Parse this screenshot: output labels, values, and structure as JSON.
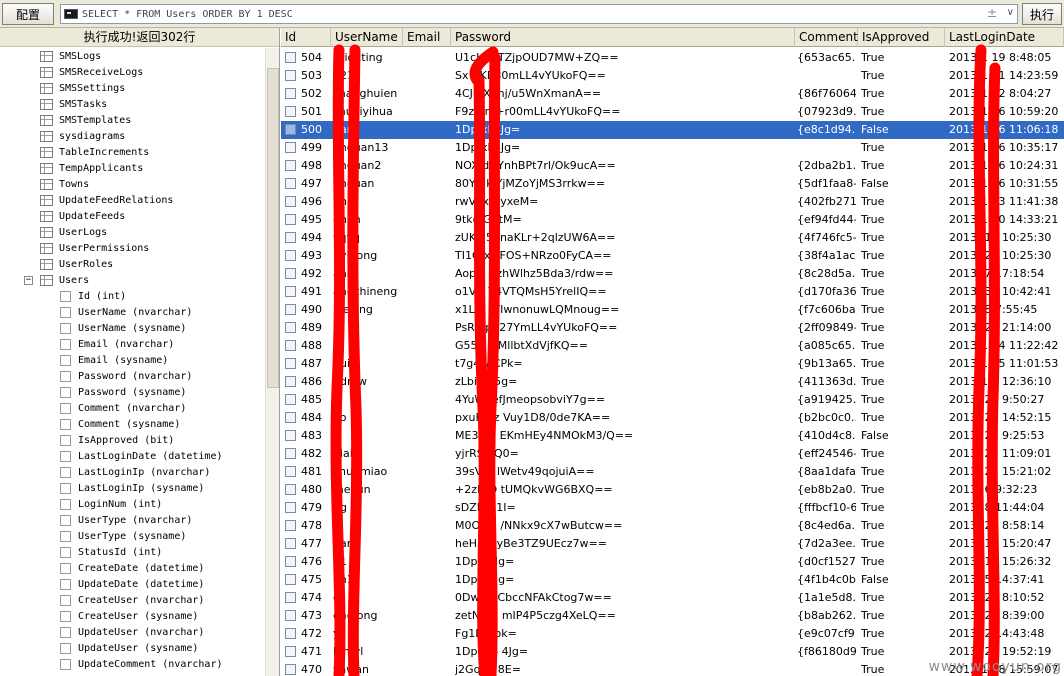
{
  "toolbar": {
    "config_label": "配置",
    "sql": "SELECT * FROM Users ORDER BY 1 DESC",
    "plus": "±",
    "dropdown": "∨",
    "exec_label": "执行"
  },
  "status": "执行成功!返回302行",
  "tree": [
    {
      "label": "SMSLogs",
      "type": "table"
    },
    {
      "label": "SMSReceiveLogs",
      "type": "table"
    },
    {
      "label": "SMSSettings",
      "type": "table"
    },
    {
      "label": "SMSTasks",
      "type": "table"
    },
    {
      "label": "SMSTemplates",
      "type": "table"
    },
    {
      "label": "sysdiagrams",
      "type": "table"
    },
    {
      "label": "TableIncrements",
      "type": "table"
    },
    {
      "label": "TempApplicants",
      "type": "table"
    },
    {
      "label": "Towns",
      "type": "table"
    },
    {
      "label": "UpdateFeedRelations",
      "type": "table"
    },
    {
      "label": "UpdateFeeds",
      "type": "table"
    },
    {
      "label": "UserLogs",
      "type": "table"
    },
    {
      "label": "UserPermissions",
      "type": "table"
    },
    {
      "label": "UserRoles",
      "type": "table"
    },
    {
      "label": "Users",
      "type": "table",
      "expanded": true,
      "expander": "−"
    },
    {
      "label": "Id (int)",
      "type": "column"
    },
    {
      "label": "UserName (nvarchar)",
      "type": "column"
    },
    {
      "label": "UserName (sysname)",
      "type": "column"
    },
    {
      "label": "Email (nvarchar)",
      "type": "column"
    },
    {
      "label": "Email (sysname)",
      "type": "column"
    },
    {
      "label": "Password (nvarchar)",
      "type": "column"
    },
    {
      "label": "Password (sysname)",
      "type": "column"
    },
    {
      "label": "Comment (nvarchar)",
      "type": "column"
    },
    {
      "label": "Comment (sysname)",
      "type": "column"
    },
    {
      "label": "IsApproved (bit)",
      "type": "column"
    },
    {
      "label": "LastLoginDate (datetime)",
      "type": "column"
    },
    {
      "label": "LastLoginIp (nvarchar)",
      "type": "column"
    },
    {
      "label": "LastLoginIp (sysname)",
      "type": "column"
    },
    {
      "label": "LoginNum (int)",
      "type": "column"
    },
    {
      "label": "UserType (nvarchar)",
      "type": "column"
    },
    {
      "label": "UserType (sysname)",
      "type": "column"
    },
    {
      "label": "StatusId (int)",
      "type": "column"
    },
    {
      "label": "CreateDate (datetime)",
      "type": "column"
    },
    {
      "label": "UpdateDate (datetime)",
      "type": "column"
    },
    {
      "label": "CreateUser (nvarchar)",
      "type": "column"
    },
    {
      "label": "CreateUser (sysname)",
      "type": "column"
    },
    {
      "label": "UpdateUser (nvarchar)",
      "type": "column"
    },
    {
      "label": "UpdateUser (sysname)",
      "type": "column"
    },
    {
      "label": "UpdateComment (nvarchar)",
      "type": "column"
    }
  ],
  "grid": {
    "columns": [
      "Id",
      "UserName",
      "Email",
      "Password",
      "Comment",
      "IsApproved",
      "LastLoginDate"
    ],
    "selected_row": 4,
    "rows": [
      [
        "504",
        "ruiouting",
        "",
        "U1cH  qiTZjpOUD7MW+ZQ==",
        "{653ac65...",
        "True",
        "2013-1  19 8:48:05"
      ],
      [
        "503",
        "  1212",
        "",
        "Sx  CKB80mLL4vYUkoFQ==",
        "",
        "True",
        "2013-1  31 14:23:59"
      ],
      [
        "502",
        "zhanghuien",
        "",
        "4CJ  TX2hj/u5WnXmanA==",
        "{86f76064...",
        "True",
        "2013-1  12 8:04:27"
      ],
      [
        "501",
        "zhuaiyihua",
        "",
        "F9z  0m+r00mLL4vYUkoFQ==",
        "{07923d9...",
        "True",
        "2013-1  16 10:59:20"
      ],
      [
        "500",
        "  dan",
        "",
        "1Dp  xk4Jg=",
        "{e8c1d94...",
        "False",
        "2013-1  16 11:06:18"
      ],
      [
        "499",
        "  anquan13",
        "",
        "1Dp  xk4Jg=",
        "",
        "True",
        "2013-1  16 10:35:17"
      ],
      [
        "498",
        "  anquan2",
        "",
        "NOX  dOYnhBPt7rl/Ok9ucA==",
        "{2dba2b1...",
        "True",
        "2013-1  16 10:24:31"
      ],
      [
        "497",
        "  anquan",
        "",
        "80Yb  kjYjMZoYjMS3rrkw==",
        "{5df1faa8-...",
        "False",
        "2013-1  16 10:31:55"
      ],
      [
        "496",
        "  ung",
        "",
        "rwVxx  CyxeM=",
        "{402fb271...",
        "True",
        "2013-1  13 11:41:38"
      ],
      [
        "495",
        "  gnan",
        "",
        "9tkd  GntM=",
        "{ef94fd44-...",
        "True",
        "2013-1  30 14:33:21"
      ],
      [
        "494",
        "  yqyq",
        "",
        "zUKu  53naKLr+2qlzUW6A==",
        "{4f746fc5-...",
        "True",
        "2013-  10 10:25:30"
      ],
      [
        "493",
        "  nyulong",
        "",
        "TI1G  xwFOS+NRzo0FyCA==",
        "{38f4a1ac...",
        "True",
        "2013-  22 10:25:30"
      ],
      [
        "492",
        "  ang",
        "",
        "Aopel  qzhWlhz5Bda3/rdw==",
        "{8c28d5a...",
        "True",
        "2013-  7 17:18:54"
      ],
      [
        "491",
        "  angzhineng",
        "",
        "o1VG  T4VTQMsH5YrelIQ==",
        "{d170fa36...",
        "True",
        "2013-  30 10:42:41"
      ],
      [
        "490",
        "  ineiling",
        "",
        "x1Lm  Z/IwnonuwLQMnoug==",
        "{f7c606ba...",
        "True",
        "2013-  8 7:55:45"
      ],
      [
        "489",
        "  1",
        "",
        "PsR4  ph27YmLL4vYUkoFQ==",
        "{2ff09849-...",
        "True",
        "2013-  20 21:14:00"
      ],
      [
        "488",
        "  sli",
        "",
        "G55E  ieMllbtXdVjfKQ==",
        "{a085c65...",
        "True",
        "2013-1  14 11:22:42"
      ],
      [
        "487",
        "  hui",
        "",
        "t7g4w  CPk=",
        "{9b13a65...",
        "True",
        "2013-1  25 11:01:53"
      ],
      [
        "486",
        "  ndrew",
        "",
        "zLbi9o  5g=",
        "{411363d...",
        "True",
        "2013-1  5 12:36:10"
      ],
      [
        "485",
        "  R",
        "",
        "4YuWj  efJmeopsobviY7g==",
        "{a919425...",
        "True",
        "2013-  28 9:50:27"
      ],
      [
        "484",
        "  ao",
        "",
        "pxuHpiz  Vuy1D8/0de7KA==",
        "{b2bc0c0...",
        "True",
        "2013-  28 14:52:15"
      ],
      [
        "483",
        "  j",
        "",
        "ME3bm  EKmHEy4NMOkM3/Q==",
        "{410d4c8...",
        "False",
        "2013-  28 9:25:53"
      ],
      [
        "482",
        "  qiai",
        "",
        "yjrRSo  Q0=",
        "{eff24546-...",
        "True",
        "2013-  24 11:09:01"
      ],
      [
        "481",
        "  chunmiao",
        "",
        "39sVrP  lWetv49qojuiA==",
        "{8aa1dafa...",
        "True",
        "2013-  21 15:21:02"
      ],
      [
        "480",
        "  meijun",
        "",
        "+2zDiQ  tUMQkvWG6BXQ==",
        "{eb8b2a0...",
        "True",
        "2013-  6 9:32:23"
      ],
      [
        "479",
        "  ng",
        "",
        "sDZDZ  1I=",
        "{fffbcf10-6...",
        "True",
        "2013-  8 11:44:04"
      ],
      [
        "478",
        "  n",
        "",
        "M0OOU  /NNkx9cX7wButcw==",
        "{8c4ed6a...",
        "True",
        "2013-  20 8:58:14"
      ],
      [
        "477",
        "  uan",
        "",
        "heHFiZ  yBe3TZ9UEcz7w==",
        "{7d2a3ee...",
        "True",
        "2013-  15 15:20:47"
      ],
      [
        "476",
        "  n1",
        "",
        "1Dpdh  Jg=",
        "{d0cf1527...",
        "True",
        "2013-  11 15:26:32"
      ],
      [
        "475",
        "  en1",
        "",
        "1Dpdh  Jg=",
        "{4f1b4c0b...",
        "False",
        "2013-  5 14:37:41"
      ],
      [
        "474",
        "  g",
        "",
        "0DwZ4  CbccNFAkCtog7w==",
        "{1a1e5d8...",
        "True",
        "2013-  26 8:10:52"
      ],
      [
        "473",
        "  englong",
        "",
        "zetNmB  mIP4P5czg4XeLQ==",
        "{b8ab262...",
        "True",
        "2013-  21 8:39:00"
      ],
      [
        "472",
        "  y",
        "",
        "Fg1Ljv  ok=",
        "{e9c07cf9...",
        "True",
        "2013-  2 14:43:48"
      ],
      [
        "471",
        "  hlmyl",
        "",
        "1Dpdho  4Jg=",
        "{f86180d9...",
        "True",
        "2013-  21 19:52:19"
      ],
      [
        "470",
        "  yawan",
        "",
        "j2Gq0T  8E=",
        "",
        "True",
        "2013-1  18 15:59:07"
      ]
    ]
  },
  "watermark": "www.wooyun.org",
  "colors": {
    "selection": "#316ac5",
    "annotation": "#ff0000"
  }
}
